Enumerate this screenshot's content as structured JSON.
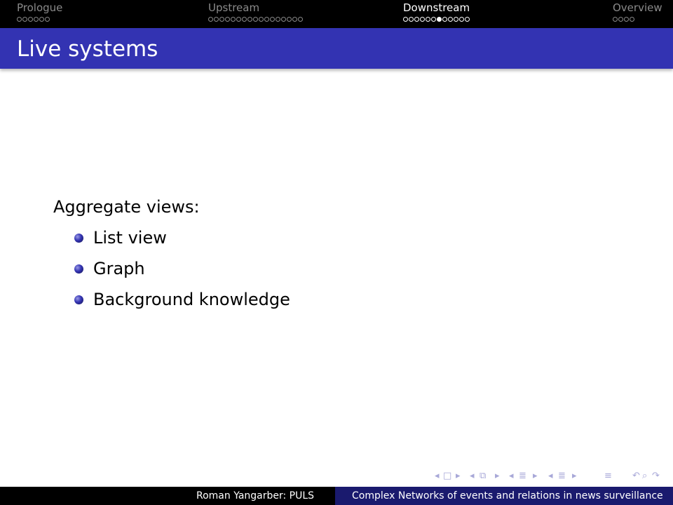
{
  "nav": {
    "sections": [
      {
        "title": "Prologue",
        "dots": 6,
        "current": -1,
        "active": false
      },
      {
        "title": "Upstream",
        "dots": 17,
        "current": -1,
        "active": false
      },
      {
        "title": "Downstream",
        "dots": 12,
        "current": 6,
        "active": true
      },
      {
        "title": "Overview",
        "dots": 4,
        "current": -1,
        "active": false
      }
    ]
  },
  "frame": {
    "title": "Live systems"
  },
  "content": {
    "lead": "Aggregate views:",
    "items": [
      "List view",
      "Graph",
      "Background knowledge"
    ]
  },
  "footer": {
    "author": "Roman Yangarber: PULS",
    "title": "Complex Networks of events and relations in news surveillance"
  },
  "nav_symbols": {
    "icons": [
      "prev-arrow-icon",
      "frame-icon",
      "next-arrow-icon",
      "prev-arrow-icon",
      "subsection-icon",
      "next-arrow-icon",
      "prev-arrow-icon",
      "section-icon",
      "next-arrow-icon",
      "prev-arrow-icon",
      "section-icon",
      "next-arrow-icon",
      "align-icon",
      "undo-icon",
      "search-icon",
      "redo-icon"
    ]
  },
  "colors": {
    "title_bar": "#3333b2",
    "nav_bar": "#000000",
    "footer_right": "#1a1a6e",
    "inactive_nav": "#8a8a8a"
  }
}
